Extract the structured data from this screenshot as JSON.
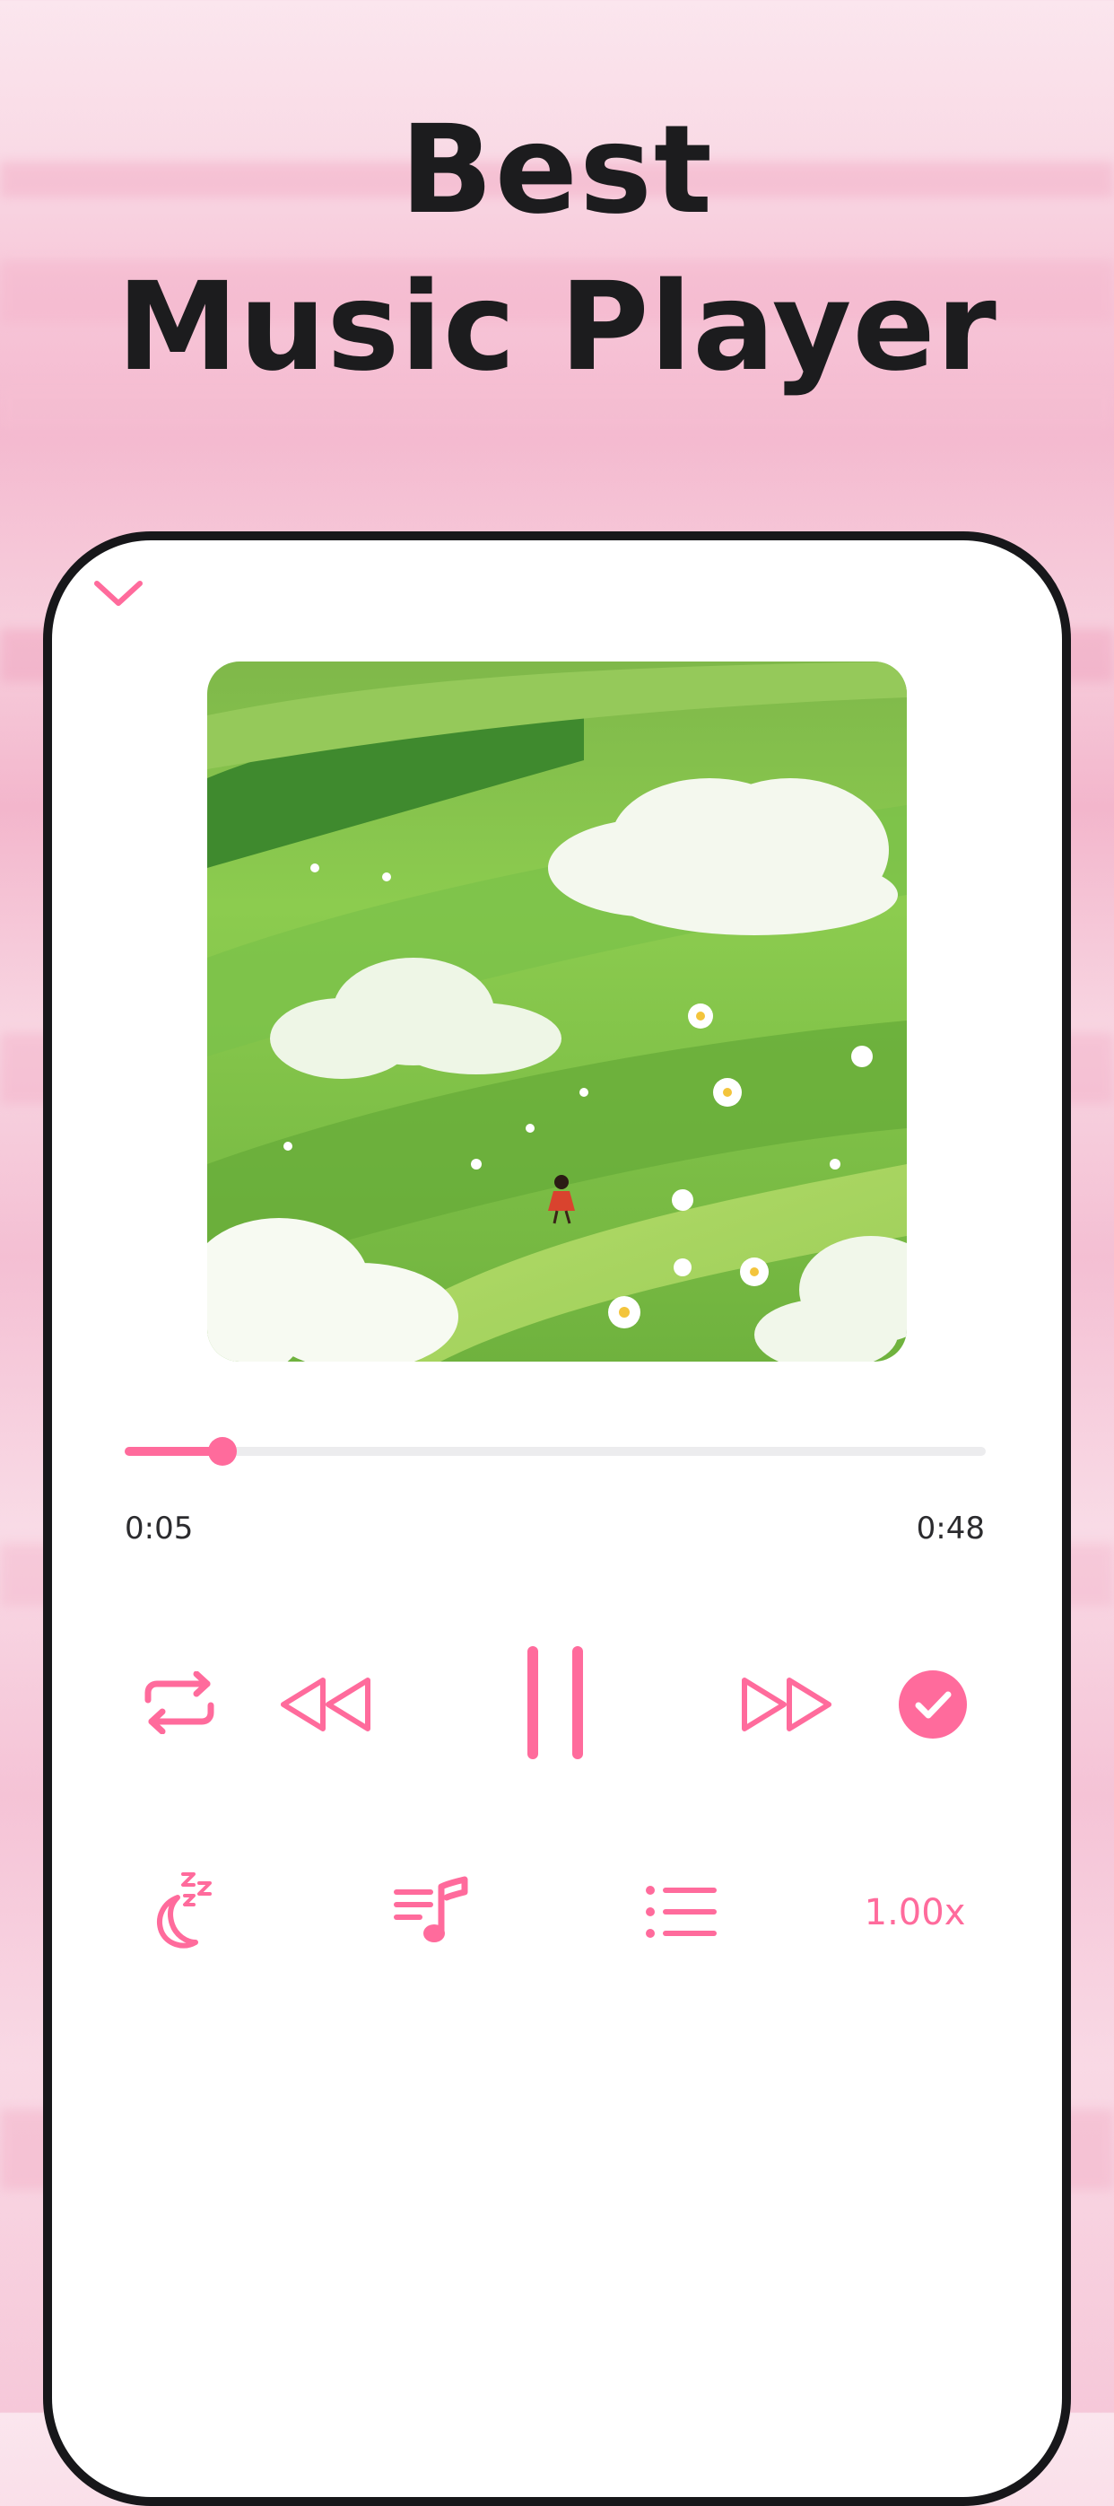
{
  "headline": {
    "line1": "Best",
    "line2": "Music Player"
  },
  "player": {
    "collapse_icon": "chevron-down-icon",
    "artwork_alt": "",
    "progress": {
      "elapsed": "0:05",
      "total": "0:48",
      "fraction": 0.114
    },
    "controls": {
      "repeat_icon": "repeat-icon",
      "rewind_icon": "rewind-icon",
      "pause_icon": "pause-icon",
      "forward_icon": "fast-forward-icon",
      "check_icon": "check-circle-icon"
    },
    "secondary": {
      "sleep_icon": "sleep-timer-icon",
      "lyrics_icon": "lyrics-icon",
      "queue_icon": "queue-list-icon",
      "speed_label": "1.00x"
    }
  },
  "colors": {
    "accent": "#ff6b9c",
    "text_dark": "#1c1c1e",
    "phone_frame": "#17171a",
    "track": "#ececee"
  }
}
